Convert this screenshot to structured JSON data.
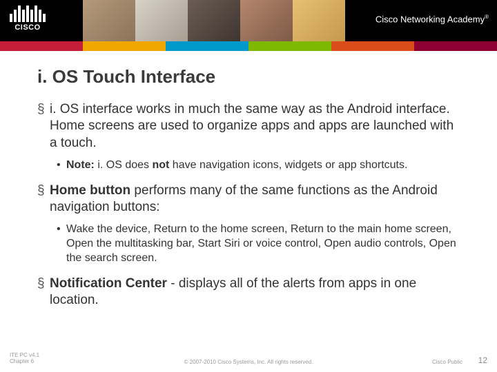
{
  "header": {
    "logo_text": "CISCO",
    "academy": "Cisco Networking Academy",
    "academy_mark": "®"
  },
  "title": "i. OS Touch Interface",
  "bullets": [
    {
      "level": 1,
      "html": "i. OS interface works in much the same way as the Android interface. Home screens are used to organize apps and apps are launched with a touch."
    },
    {
      "level": 2,
      "html": "<b>Note:</b> i. OS does <b>not</b> have navigation icons, widgets or app shortcuts."
    },
    {
      "level": 1,
      "html": "<b>Home button</b> performs many of the same functions as the Android navigation buttons:"
    },
    {
      "level": 2,
      "html": "Wake the device, Return to the home screen, Return to the main home screen, Open the multitasking bar, Start Siri or voice control, Open audio controls, Open the search screen."
    },
    {
      "level": 1,
      "html": "<b>Notification Center</b> -  displays all of the alerts from apps in one location."
    }
  ],
  "footer": {
    "left_line1": "ITE PC v4.1",
    "left_line2": "Chapter 6",
    "center": "© 2007-2010 Cisco Systems, Inc. All rights reserved.",
    "right": "Cisco Public",
    "page": "12"
  }
}
